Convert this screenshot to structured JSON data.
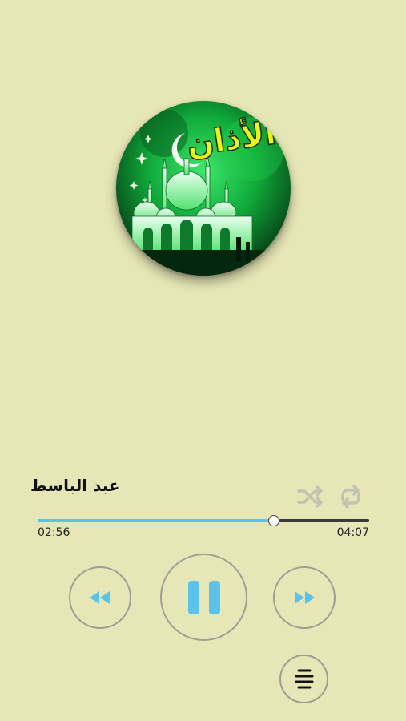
{
  "artwork": {
    "logo_text": "الأذان"
  },
  "player": {
    "title": "عبد الباسط",
    "elapsed": "02:56",
    "total": "04:07",
    "progress": 0.71,
    "shuffle_icon": "shuffle-icon",
    "repeat_icon": "repeat-icon",
    "rewind_icon": "rewind-icon",
    "pause_icon": "pause-icon",
    "forward_icon": "fast-forward-icon",
    "playlist_icon": "playlist-icon"
  },
  "colors": {
    "background": "#e6e6b6",
    "accent": "#5bc3ea",
    "button_border": "#9e9e96",
    "inactive_icon": "#c2c2b0"
  }
}
